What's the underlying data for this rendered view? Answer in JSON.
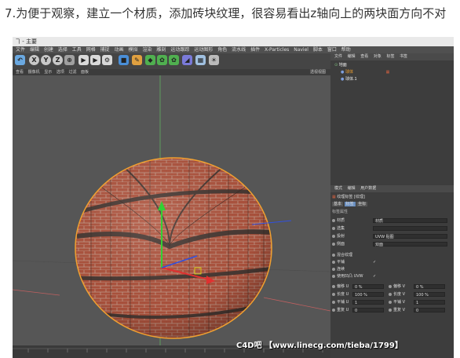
{
  "caption": "7.为便于观察，建立一个材质，添加砖块纹理，很容易看出z轴向上的两块面方向不对",
  "window": {
    "title": "ヿ - 主要"
  },
  "menubar": [
    "文件",
    "编辑",
    "创建",
    "选择",
    "工具",
    "网格",
    "捕捉",
    "动画",
    "模拟",
    "渲染",
    "雕刻",
    "运动跟踪",
    "运动图形",
    "角色",
    "流水线",
    "插件",
    "X-Particles",
    "Naviel",
    "脚本",
    "窗口",
    "帮助"
  ],
  "toolbar_icons": [
    "undo-icon",
    "axis-x",
    "axis-y",
    "axis-z",
    "world-icon",
    "render-view-icon",
    "render-icon",
    "render-settings-icon",
    "cube-icon",
    "pen-icon",
    "subdivision-icon",
    "cloner-icon",
    "deformer-icon",
    "floor-icon",
    "camera-icon",
    "light-icon"
  ],
  "axis_labels": {
    "x": "X",
    "y": "Y",
    "z": "Z"
  },
  "viewport": {
    "menu": [
      "查看",
      "摄像机",
      "显示",
      "选项",
      "过滤",
      "面板"
    ],
    "label": "透视视图"
  },
  "object_manager": {
    "menu": [
      "文件",
      "编辑",
      "查看",
      "对象",
      "标签",
      "书签"
    ],
    "objects": [
      {
        "name": "地面",
        "level": 0
      },
      {
        "name": "球体",
        "level": 1
      },
      {
        "name": "球体.1",
        "level": 1
      }
    ]
  },
  "attributes": {
    "menu": [
      "模式",
      "编辑",
      "用户数据"
    ],
    "tag_title": "纹理标签 [纹理]",
    "tabs": [
      "基本",
      "标签",
      "坐标"
    ],
    "section": "标签属性",
    "rows": [
      {
        "label": "材质",
        "value": "材质"
      },
      {
        "label": "选集",
        "value": ""
      },
      {
        "label": "投射",
        "value": "UVW 贴图"
      },
      {
        "label": "侧面",
        "value": "双面"
      },
      {
        "label": "混合纹理",
        "value": ""
      },
      {
        "label": "平铺",
        "value": "✓"
      },
      {
        "label": "连续",
        "value": ""
      },
      {
        "label": "使用凹凸 UVW",
        "value": "✓"
      }
    ],
    "pairs": [
      {
        "l1": "偏移 U",
        "v1": "0 %",
        "l2": "偏移 V",
        "v2": "0 %"
      },
      {
        "l1": "长度 U",
        "v1": "100 %",
        "l2": "长度 V",
        "v2": "100 %"
      },
      {
        "l1": "平铺 U",
        "v1": "1",
        "l2": "平铺 V",
        "v2": "1"
      },
      {
        "l1": "重复 U",
        "v1": "0",
        "l2": "重复 V",
        "v2": "0"
      }
    ]
  },
  "watermark": "C4D吧 【www.linecg.com/tieba/1799】",
  "colors": {
    "brick": "#b0543e",
    "mortar": "#c7a08f",
    "dark_band": "#4a3a34",
    "viewport_bg": "#565656",
    "highlight": "#f0a030"
  }
}
